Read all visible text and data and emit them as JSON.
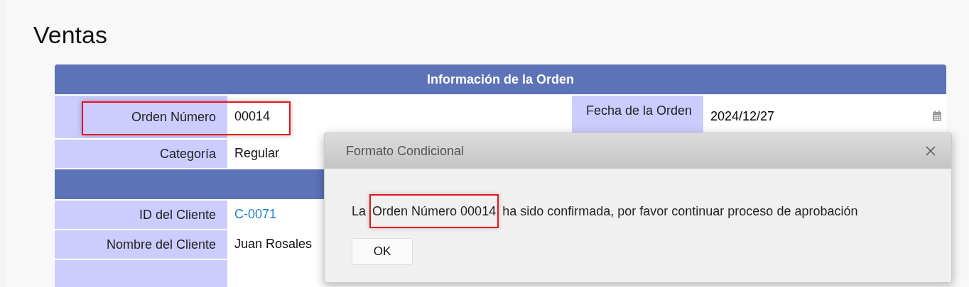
{
  "page_title": "Ventas",
  "form": {
    "header": "Información de la Orden",
    "rows": [
      {
        "kind": "field",
        "label": "Orden Número",
        "value": "00014",
        "highlighted": true,
        "side_label": "Fecha de la Orden",
        "side_value": "2024/12/27"
      },
      {
        "kind": "field",
        "label": "Categoría",
        "value": "Regular",
        "highlighted": false
      },
      {
        "kind": "section"
      },
      {
        "kind": "link",
        "label": "ID del Cliente",
        "value": "C-0071",
        "highlighted": false
      },
      {
        "kind": "field",
        "label": "Nombre del Cliente",
        "value": "Juan Rosales",
        "highlighted": false
      },
      {
        "kind": "blank"
      }
    ]
  },
  "dialog": {
    "title": "Formato Condicional",
    "message": {
      "before": "La",
      "highlighted": "Orden Número 00014",
      "after": "ha sido confirmada, por favor continuar proceso de aprobación"
    },
    "buttons": [
      "OK"
    ]
  }
}
